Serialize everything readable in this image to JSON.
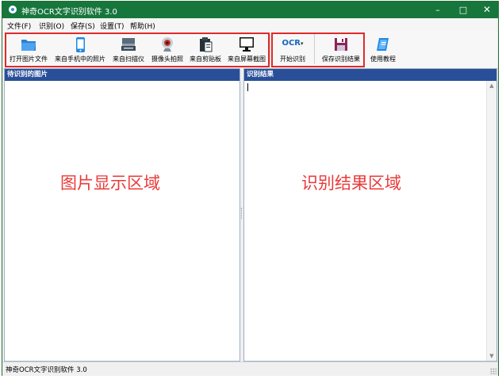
{
  "window": {
    "title": "神奇OCR文字识别软件 3.0",
    "controls": {
      "minimize": "–",
      "maximize": "□",
      "close": "✕"
    }
  },
  "menu": [
    "文件(F)",
    "识别(O)",
    "保存(S)",
    "设置(T)",
    "帮助(H)"
  ],
  "toolbar": {
    "open_image": "打开图片文件",
    "from_phone": "来自手机中的照片",
    "from_scanner": "来自扫描仪",
    "camera": "摄像头拍照",
    "from_clipboard": "来自剪贴板",
    "screenshot": "来自屏幕截图",
    "start_ocr": "开始识别",
    "ocr_icon_text": "OCR",
    "save_result": "保存识别结果",
    "tutorial": "使用教程"
  },
  "left_panel": {
    "header": "待识别的图片",
    "area_label": "图片显示区域"
  },
  "right_panel": {
    "header": "识别结果",
    "area_label": "识别结果区域"
  },
  "status": {
    "text": "神奇OCR文字识别软件 3.0"
  },
  "colors": {
    "titlebar": "#17763c",
    "panel_header": "#2a4f99",
    "annotation_red": "#e02a2a"
  }
}
